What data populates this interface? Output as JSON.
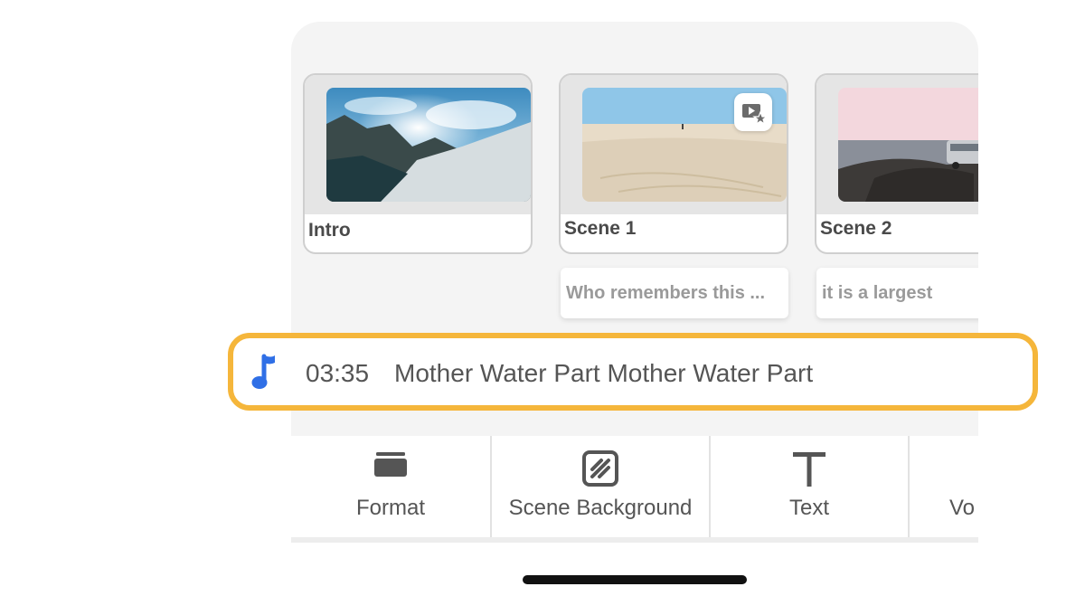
{
  "scenes": [
    {
      "label": "Intro"
    },
    {
      "label": "Scene 1",
      "badge_icon": "video-star-icon"
    },
    {
      "label": "Scene 2"
    }
  ],
  "captions": [
    {
      "text": "Who remembers this ..."
    },
    {
      "text": "it is a largest"
    }
  ],
  "music": {
    "icon": "music-note-icon",
    "time": "03:35",
    "title": "Mother Water Part Mother Water Part",
    "highlight_color": "#f5b63b",
    "icon_color": "#2f6fe6"
  },
  "toolbar": {
    "items": [
      {
        "label": "Format",
        "icon": "format-icon"
      },
      {
        "label": "Scene Background",
        "icon": "scene-background-icon"
      },
      {
        "label": "Text",
        "icon": "text-icon"
      },
      {
        "label": "Vo",
        "icon": "voice-icon"
      }
    ]
  }
}
